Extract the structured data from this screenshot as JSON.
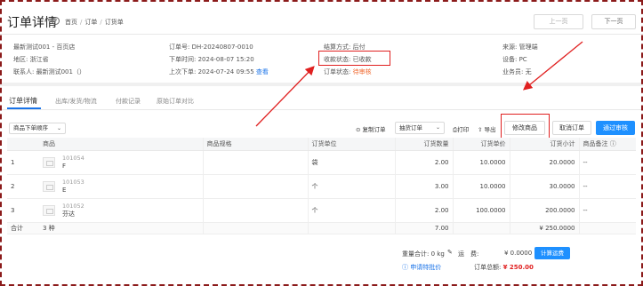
{
  "header": {
    "title": "订单详情",
    "help_icon": "?",
    "breadcrumb": [
      "首页",
      "订单",
      "订货单"
    ],
    "prev_label": "上一页",
    "next_label": "下一页"
  },
  "info": {
    "customer": "最新测试001 - 百页店",
    "region": "地区: 浙江省",
    "contact": "联系人: 最新测试001（）",
    "order_no": "订单号: DH-20240807-0010",
    "order_time": "下单时间: 2024-08-07 15:20",
    "last_order_prefix": "上次下单: 2024-07-24 09:55",
    "last_order_link": "查看",
    "settle": "结算方式: 后付",
    "pay_status": "收款状态: 已收款",
    "order_status_label": "订单状态: ",
    "order_status_value": "待审核",
    "source": "来源: 管理端",
    "device": "设备: PC",
    "salesman": "业务员: 无"
  },
  "tabs": [
    "订单详情",
    "出库/发货/物流",
    "付款记录",
    "原始订单对比"
  ],
  "toolbar": {
    "sort_select": "商品下单顺序",
    "copy_order": "复制订单",
    "type_select": "抽货订单",
    "print": "打印",
    "export": "导出",
    "modify_goods": "修改商品",
    "cancel_order": "取消订单",
    "approve": "通过审核",
    "copy_icon": "copy-icon",
    "print_icon": "print-icon",
    "export_icon": "export-icon"
  },
  "table": {
    "headers": [
      "商品",
      "商品规格",
      "订货单位",
      "订货数量",
      "订货单价",
      "订货小计",
      "商品备注"
    ],
    "rows": [
      {
        "idx": "1",
        "code": "101054",
        "name": "F",
        "spec": "",
        "unit": "袋",
        "qty": "2.00",
        "price": "10.0000",
        "subtotal": "20.0000",
        "remark": "--"
      },
      {
        "idx": "2",
        "code": "101053",
        "name": "E",
        "spec": "",
        "unit": "个",
        "qty": "3.00",
        "price": "10.0000",
        "subtotal": "30.0000",
        "remark": "--"
      },
      {
        "idx": "3",
        "code": "101052",
        "name": "芬达",
        "spec": "",
        "unit": "个",
        "qty": "2.00",
        "price": "100.0000",
        "subtotal": "200.0000",
        "remark": "--"
      }
    ],
    "total_label": "合计",
    "total_kinds": "3 种",
    "total_qty": "7.00",
    "total_amount": "¥ 250.0000"
  },
  "footer": {
    "weight": "重量合计: 0 kg",
    "freight_label": "运　费:",
    "freight_value": "¥ 0.0000",
    "calc_freight": "计算运费",
    "apply_price": "申请特批价",
    "order_total_label": "订单总额:",
    "order_total_value": "¥ 250.00"
  },
  "colors": {
    "accent": "#1e90ff",
    "warn": "#f0672d",
    "highlight": "#e02020"
  }
}
